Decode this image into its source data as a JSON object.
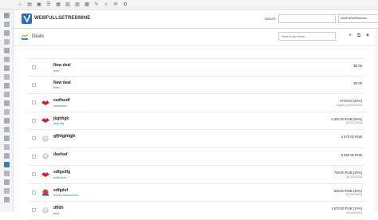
{
  "header": {
    "brand": "WEBFULLSETREDMINE",
    "search_label": "Search:",
    "search_placeholder": "",
    "project": "WebFullSetRedmine"
  },
  "page": {
    "title": "Deals",
    "filter_placeholder": "Search by name"
  },
  "colors": {
    "accent": "#3b7bbf",
    "logo_blue": "#2b6ccf"
  },
  "deals": [
    {
      "name": "New deal",
      "contact": "testr",
      "amount": "$0.00",
      "meta": "",
      "thumb": "none"
    },
    {
      "name": "New deal",
      "contact": "testr",
      "amount": "$0.00",
      "meta": "",
      "thumb": "none"
    },
    {
      "name": "sedfsedf",
      "contact": "webtoken",
      "amount": "€748.00 (20%)",
      "meta": "sdgdfs (01/03/2020)",
      "thumb": "logo-red"
    },
    {
      "name": "jkghhgk",
      "contact": "efghdfg",
      "amount": "9 382.00 RUB (50%)",
      "meta": "(21/01/2020)",
      "thumb": "logo-red"
    },
    {
      "name": "gfjhfgjhfgjh",
      "contact": "",
      "amount": "2 670.00 RUB",
      "meta": "",
      "thumb": "avatar-grey"
    },
    {
      "name": "dasfsaf",
      "contact": "",
      "amount": "5 880.00 RUB",
      "meta": "",
      "thumb": "avatar-grey"
    },
    {
      "name": "sdfgsdfg",
      "contact": "webtoken",
      "amount": "748.00 RUB (20%)",
      "meta": "(01/03/2020)",
      "thumb": "logo-red"
    },
    {
      "name": "sdfgdsf",
      "contact": "testan financieros",
      "amount": "535.00 RUB (30%)",
      "meta": "(21/01/2020)",
      "thumb": "logo-colorful"
    },
    {
      "name": "dffdh",
      "contact": "testr",
      "amount": "1 570.00 RUB (10%)",
      "meta": "(01/03/2020)",
      "thumb": "avatar-grey"
    }
  ]
}
